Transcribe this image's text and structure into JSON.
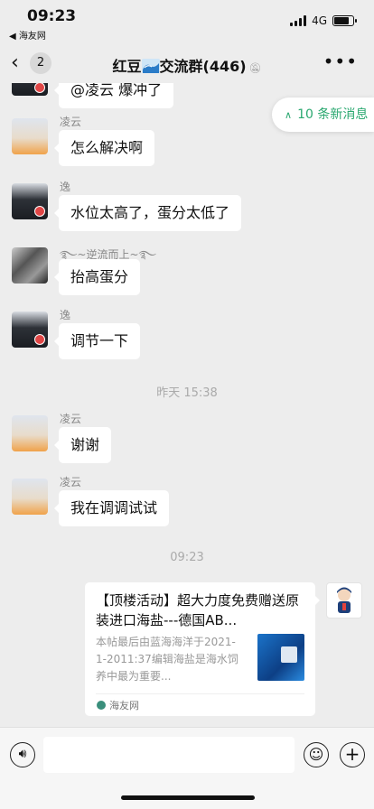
{
  "status": {
    "time": "09:23",
    "back_app": "◀ 海友网",
    "network": "4G"
  },
  "header": {
    "unread_count": "2",
    "title": "红豆",
    "title_suffix": "交流群(446)"
  },
  "new_messages": {
    "label": "10 条新消息"
  },
  "messages": [
    {
      "text": "@凌云 爆冲了"
    },
    {
      "name": "凌云",
      "text": "怎么解决啊"
    },
    {
      "name": "逸",
      "text": "水位太高了，蛋分太低了"
    },
    {
      "name": "࿐~逆流而上~࿐",
      "text": "抬高蛋分"
    },
    {
      "name": "逸",
      "text": "调节一下"
    },
    {
      "name": "凌云",
      "text": "谢谢"
    },
    {
      "name": "凌云",
      "text": "我在调调试试"
    }
  ],
  "timestamps": [
    "昨天 15:38",
    "09:23"
  ],
  "link_card": {
    "title": "【顶楼活动】超大力度免费赠送原装进口海盐---德国AB...",
    "description": "本帖最后由蓝海海洋于2021-1-2011:37编辑海盐是海水饲养中最为重要...",
    "source": "海友网"
  },
  "icons": {
    "back": "chevron-left-icon",
    "mute": "bell-muted-icon",
    "more": "more-dots-icon",
    "voice": "voice-icon",
    "emoji": "emoji-icon",
    "add": "plus-icon"
  },
  "colors": {
    "accent": "#2aa870",
    "background": "#ededed",
    "bubble": "#ffffff"
  }
}
